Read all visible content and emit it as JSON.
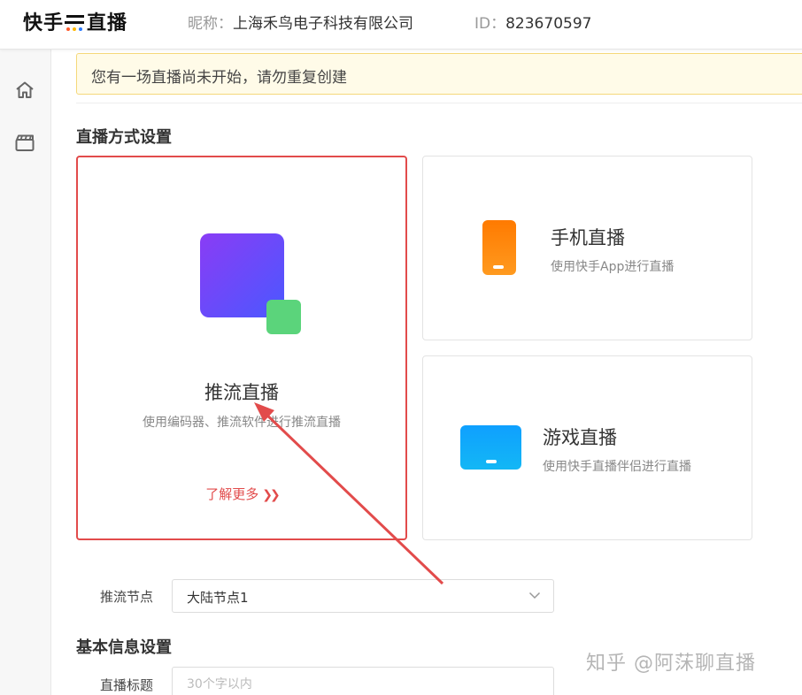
{
  "header": {
    "logo_part1": "快手",
    "logo_part2": "直播",
    "nickname_label": "昵称：",
    "nickname_value": "上海禾鸟电子科技有限公司",
    "id_label": "ID：",
    "id_value": "823670597"
  },
  "sidebar": {
    "items": [
      {
        "icon": "home-icon"
      },
      {
        "icon": "clapperboard-icon"
      }
    ]
  },
  "notice": {
    "text": "您有一场直播尚未开始，请勿重复创建"
  },
  "live_mode": {
    "section_title": "直播方式设置",
    "push": {
      "title": "推流直播",
      "desc": "使用编码器、推流软件进行推流直播",
      "learn_more": "了解更多",
      "selected": true
    },
    "mobile": {
      "title": "手机直播",
      "desc": "使用快手App进行直播"
    },
    "game": {
      "title": "游戏直播",
      "desc": "使用快手直播伴侣进行直播"
    }
  },
  "push_node": {
    "label": "推流节点",
    "value": "大陆节点1"
  },
  "basic_info": {
    "section_title": "基本信息设置",
    "title_label": "直播标题",
    "title_placeholder": "30个字以内"
  },
  "watermark": "知乎 @阿莯聊直播",
  "colors": {
    "accent_red": "#e24b4b",
    "purple": "#8a3cf5",
    "green": "#5bd47b",
    "orange": "#ff7a00",
    "blue": "#0fa0ff"
  }
}
